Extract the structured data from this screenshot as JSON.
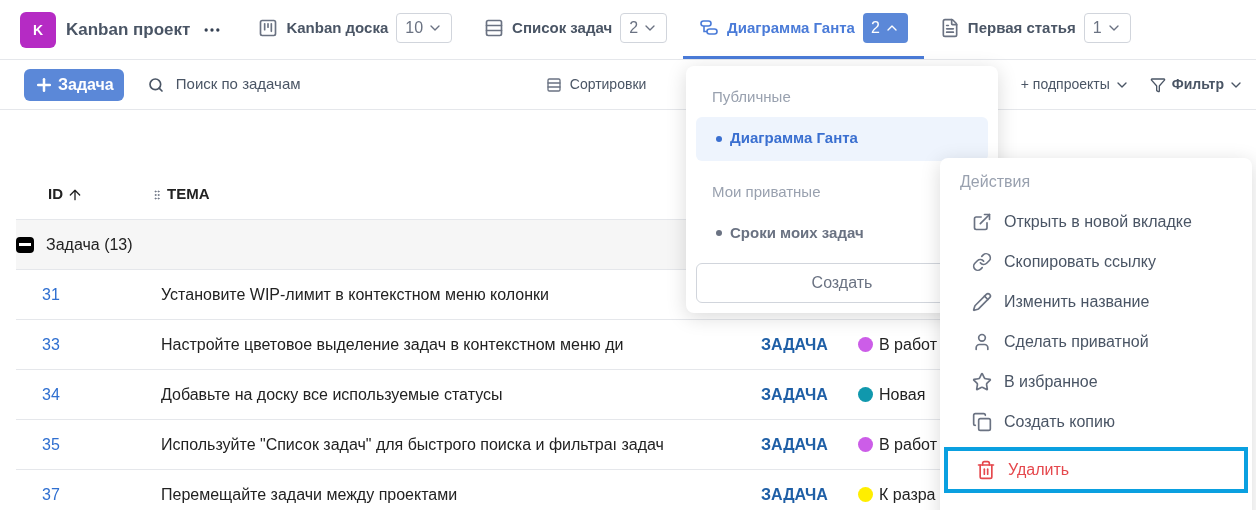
{
  "project": {
    "initial": "K",
    "name": "Kanban проект"
  },
  "tabs": [
    {
      "kind": "board",
      "label": "Kanban доска",
      "count": "10",
      "selected": false
    },
    {
      "kind": "list",
      "label": "Список задач",
      "count": "2",
      "selected": false
    },
    {
      "kind": "gantt",
      "label": "Диаграмма Ганта",
      "count": "2",
      "selected": true
    },
    {
      "kind": "wiki",
      "label": "Первая статья",
      "count": "1",
      "selected": false
    }
  ],
  "toolbar": {
    "add_button": "Задача",
    "search_placeholder": "Поиск по задачам",
    "sort": "Сортировки",
    "subprojects": "+ подпроекты",
    "filter": "Фильтр"
  },
  "table": {
    "columns": [
      "ID",
      "ТЕМА"
    ],
    "group": {
      "label": "Задача (13)",
      "expanded": true
    },
    "rows": [
      {
        "id": "31",
        "subject": "Установите WIP-лимит в контекстном меню колонки"
      },
      {
        "id": "33",
        "subject": "Настройте цветовое выделение задач в контекстном меню ди",
        "type": "ЗАДАЧА",
        "status": "В работ",
        "color": "#cc5de8"
      },
      {
        "id": "34",
        "subject": "Добавьте на доску все используемые статусы",
        "type": "ЗАДАЧА",
        "status": "Новая",
        "color": "#1098ad"
      },
      {
        "id": "35",
        "subject": "Используйте \"Список задач\" для быстрого поиска и фильтраı задач",
        "type": "ЗАДАЧА",
        "status": "В работ",
        "color": "#cc5de8"
      },
      {
        "id": "37",
        "subject": "Перемещайте задачи между проектами",
        "type": "ЗАДАЧА",
        "status": "К разра",
        "color": "#ffee00"
      }
    ]
  },
  "views_menu": {
    "sections": [
      {
        "title": "Публичные",
        "items": [
          {
            "label": "Диаграмма Ганта",
            "selected": true
          }
        ]
      },
      {
        "title": "Мои приватные",
        "items": [
          {
            "label": "Сроки моих задач",
            "selected": false
          }
        ]
      }
    ],
    "create_button": "Создать"
  },
  "actions_menu": {
    "title": "Действия",
    "items": [
      {
        "label": "Открыть в новой вкладке",
        "danger": false,
        "highlighted": false
      },
      {
        "label": "Скопировать ссылку",
        "danger": false,
        "highlighted": false
      },
      {
        "label": "Изменить название",
        "danger": false,
        "highlighted": false
      },
      {
        "label": "Сделать приватной",
        "danger": false,
        "highlighted": false
      },
      {
        "label": "В избранное",
        "danger": false,
        "highlighted": false
      },
      {
        "label": "Создать копию",
        "danger": false,
        "highlighted": false
      },
      {
        "label": "Удалить",
        "danger": true,
        "highlighted": true
      }
    ]
  }
}
